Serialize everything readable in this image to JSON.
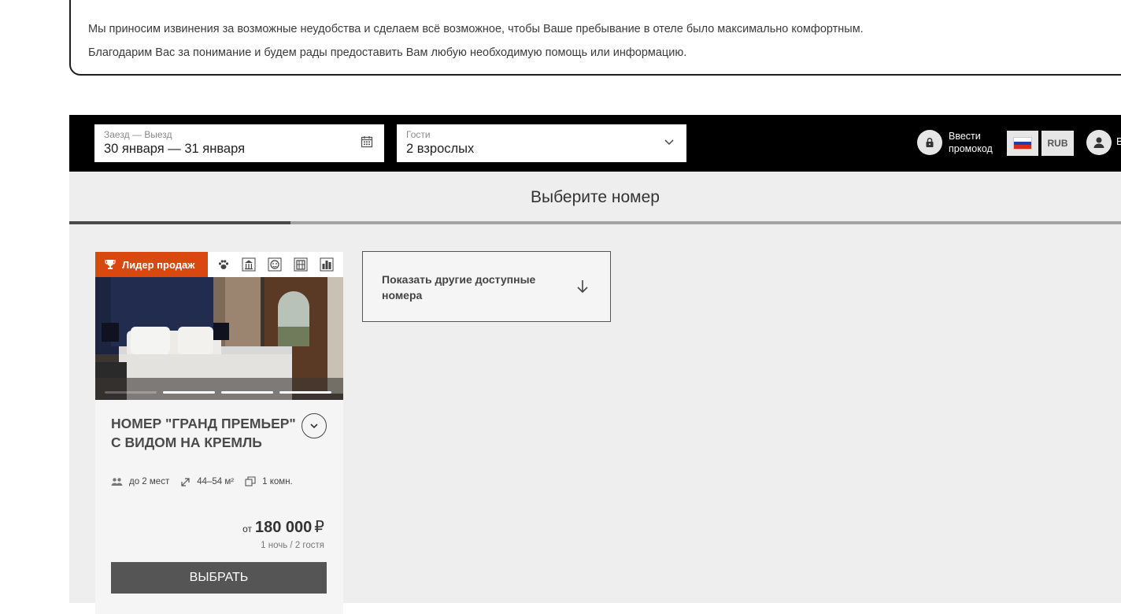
{
  "notice": {
    "line1": "Мы приносим извинения за возможные неудобства и сделаем всё возможное, чтобы Ваше пребывание в отеле было максимально комфортным.",
    "line2": "Благодарим Вас за понимание и будем рады предоставить Вам любую необходимую помощь или информацию."
  },
  "search": {
    "dates_label": "Заезд — Выезд",
    "dates_value": "30 января — 31 января",
    "guests_label": "Гости",
    "guests_value": "2 взрослых",
    "promo_label_1": "Ввести",
    "promo_label_2": "промокод",
    "currency": "RUB",
    "user_label": "В"
  },
  "page": {
    "title": "Выберите номер",
    "progress_fraction": 0.21
  },
  "room": {
    "badge": "Лидер продаж",
    "amenity_icons": [
      "paw-icon",
      "museum-icon",
      "theater-icon",
      "building-icon",
      "city-icon"
    ],
    "name": "НОМЕР \"ГРАНД ПРЕМЬЕР\" С ВИДОМ НА КРЕМЛЬ",
    "capacity": "до 2 мест",
    "area": "44–54 м²",
    "rooms": "1 комн.",
    "price_prefix": "от",
    "price": "180 000",
    "currency_symbol": "₽",
    "price_note": "1 ночь / 2 гостя",
    "select_label": "ВЫБРАТЬ",
    "gallery_active_index": 1,
    "gallery_count": 4
  },
  "more": {
    "label": "Показать другие доступные номера"
  },
  "colors": {
    "badge": "#d9480f",
    "header": "#000000",
    "select_button": "#555555"
  }
}
